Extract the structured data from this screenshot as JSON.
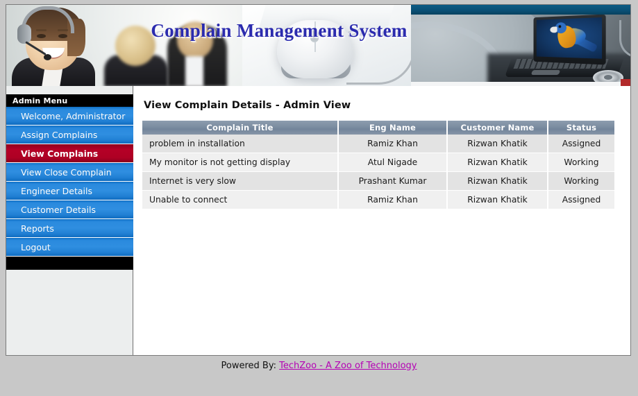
{
  "banner": {
    "title": "Complain Management System",
    "left_photo_alt": "call-center-agents-photo",
    "mid_photo_alt": "computer-mouse-keyboard-photo",
    "right_photo_alt": "laptop-with-parrot-wallpaper-photo"
  },
  "sidebar": {
    "header": "Admin Menu",
    "items": [
      {
        "label": "Welcome, Administrator",
        "active": false
      },
      {
        "label": "Assign Complains",
        "active": false
      },
      {
        "label": "View Complains",
        "active": true
      },
      {
        "label": "View Close Complain",
        "active": false
      },
      {
        "label": "Engineer Details",
        "active": false
      },
      {
        "label": "Customer Details",
        "active": false
      },
      {
        "label": "Reports",
        "active": false
      },
      {
        "label": "Logout",
        "active": false
      }
    ]
  },
  "content": {
    "page_title": "View Complain Details - Admin View",
    "table": {
      "columns": [
        "Complain Title",
        "Eng Name",
        "Customer Name",
        "Status"
      ],
      "rows": [
        {
          "complain_title": "problem in installation",
          "eng_name": "Ramiz Khan",
          "customer_name": "Rizwan Khatik",
          "status": "Assigned"
        },
        {
          "complain_title": "My monitor is not getting display",
          "eng_name": "Atul Nigade",
          "customer_name": "Rizwan Khatik",
          "status": "Working"
        },
        {
          "complain_title": "Internet is very slow",
          "eng_name": "Prashant Kumar",
          "customer_name": "Rizwan Khatik",
          "status": "Working"
        },
        {
          "complain_title": "Unable to connect",
          "eng_name": "Ramiz Khan",
          "customer_name": "Rizwan Khatik",
          "status": "Assigned"
        }
      ]
    }
  },
  "footer": {
    "powered_by": "Powered By:",
    "link_text": "TechZoo - A Zoo of Technology"
  },
  "colors": {
    "title_blue": "#2b2bae",
    "menu_blue": "#2f8ee0",
    "menu_active_red": "#b50026",
    "table_header_slate": "#7c8da1",
    "row_odd": "#e3e3e3",
    "row_even": "#f0f0f0",
    "footer_link_magenta": "#b400b4",
    "page_bg": "#c8c8c8",
    "header_strip_teal": "#0a4f74"
  }
}
